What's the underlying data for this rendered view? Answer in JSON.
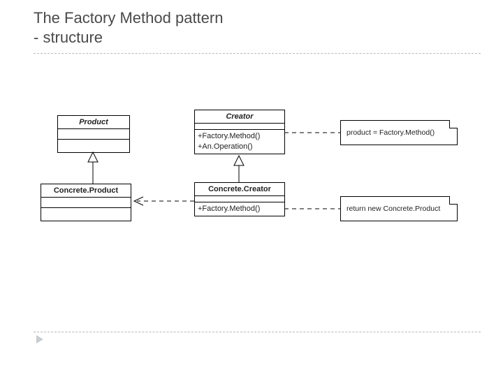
{
  "title_line1": "The Factory Method pattern",
  "title_line2": "- structure",
  "classes": {
    "product": {
      "name": "Product"
    },
    "concreteProduct": {
      "name": "Concrete.Product"
    },
    "creator": {
      "name": "Creator",
      "op1": "+Factory.Method()",
      "op2": "+An.Operation()"
    },
    "concreteCreator": {
      "name": "Concrete.Creator",
      "op1": "+Factory.Method()"
    }
  },
  "notes": {
    "n1": "product = Factory.Method()",
    "n2": "return new Concrete.Product"
  }
}
